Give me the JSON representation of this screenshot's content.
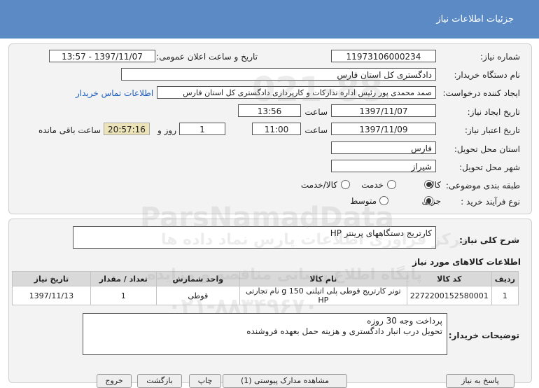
{
  "header": {
    "title": "جزئیات اطلاعات نیاز"
  },
  "form": {
    "need_number_label": "شماره نیاز:",
    "need_number": "11973106000234",
    "announce_label": "تاریخ و ساعت اعلان عمومی:",
    "announce_value": "1397/11/07 - 13:57",
    "buyer_org_label": "نام دستگاه خریدار:",
    "buyer_org": "دادگستری کل استان فارس",
    "requester_label": "ایجاد کننده درخواست:",
    "requester": "صمد محمدی پور رئیس اداره تدارکات و کارپردازی دادگستری کل استان فارس",
    "contact_link": "اطلاعات تماس خریدار",
    "created_label": "تاریخ ایجاد نیاز:",
    "created_date": "1397/11/07",
    "time_label": "ساعت",
    "created_time": "13:56",
    "validity_label": "تاریخ اعتبار نیاز:",
    "validity_date": "1397/11/09",
    "validity_time": "11:00",
    "days_value": "1",
    "days_label": "روز و",
    "remaining_time": "20:57:16",
    "remaining_label": "ساعت باقی مانده",
    "province_label": "استان محل تحویل:",
    "province": "فارس",
    "city_label": "شهر محل تحویل:",
    "city": "شیراز",
    "category_label": "طبقه بندی موضوعی:",
    "category_options": [
      "کالا",
      "خدمت",
      "کالا/خدمت"
    ],
    "process_label": "نوع فرآیند خرید :",
    "process_options": [
      "جزیی",
      "متوسط"
    ]
  },
  "summary": {
    "label": "شرح کلی نیاز:",
    "text": "کارتریج دستگاههای پرینتر HP"
  },
  "items": {
    "section_title": "اطلاعات کالاهای مورد نیاز",
    "columns": [
      "ردیف",
      "کد کالا",
      "نام کالا",
      "واحد شمارش",
      "تعداد / مقدار",
      "تاریخ نیاز"
    ],
    "rows": [
      [
        "1",
        "2272200152580001",
        "تونر کارتریج قوطی پلی اتیلنی 150 g نام تجارتی HP",
        "قوطی",
        "1",
        "1397/11/13"
      ]
    ]
  },
  "buyer_notes": {
    "label": "توضیحات خریدار:",
    "line1": "پرداخت وجه 30 روزه",
    "line2": "تحویل درب انبار دادگستری و هزینه حمل بعهده فروشنده"
  },
  "buttons": {
    "reply": "پاسخ به نیاز",
    "docs": "مشاهده مدارک پیوستی (1)",
    "print": "چاپ",
    "back": "بازگشت",
    "exit": "خروج"
  },
  "watermark": {
    "latin": "ParsNamadData",
    "fa1": "مرکز فراوری اطلاعات پارس نماد داده ها",
    "fa2": "پایگاه اطلاع رسانی مناقصه و مزایده",
    "phone": "۰۲۱-۸۸۳۴۹۶۷۰",
    "digits": "021-88"
  },
  "colors": {
    "header": "#5b8ac5",
    "link": "#1f5fbf",
    "panel": "#f3f3f3"
  }
}
